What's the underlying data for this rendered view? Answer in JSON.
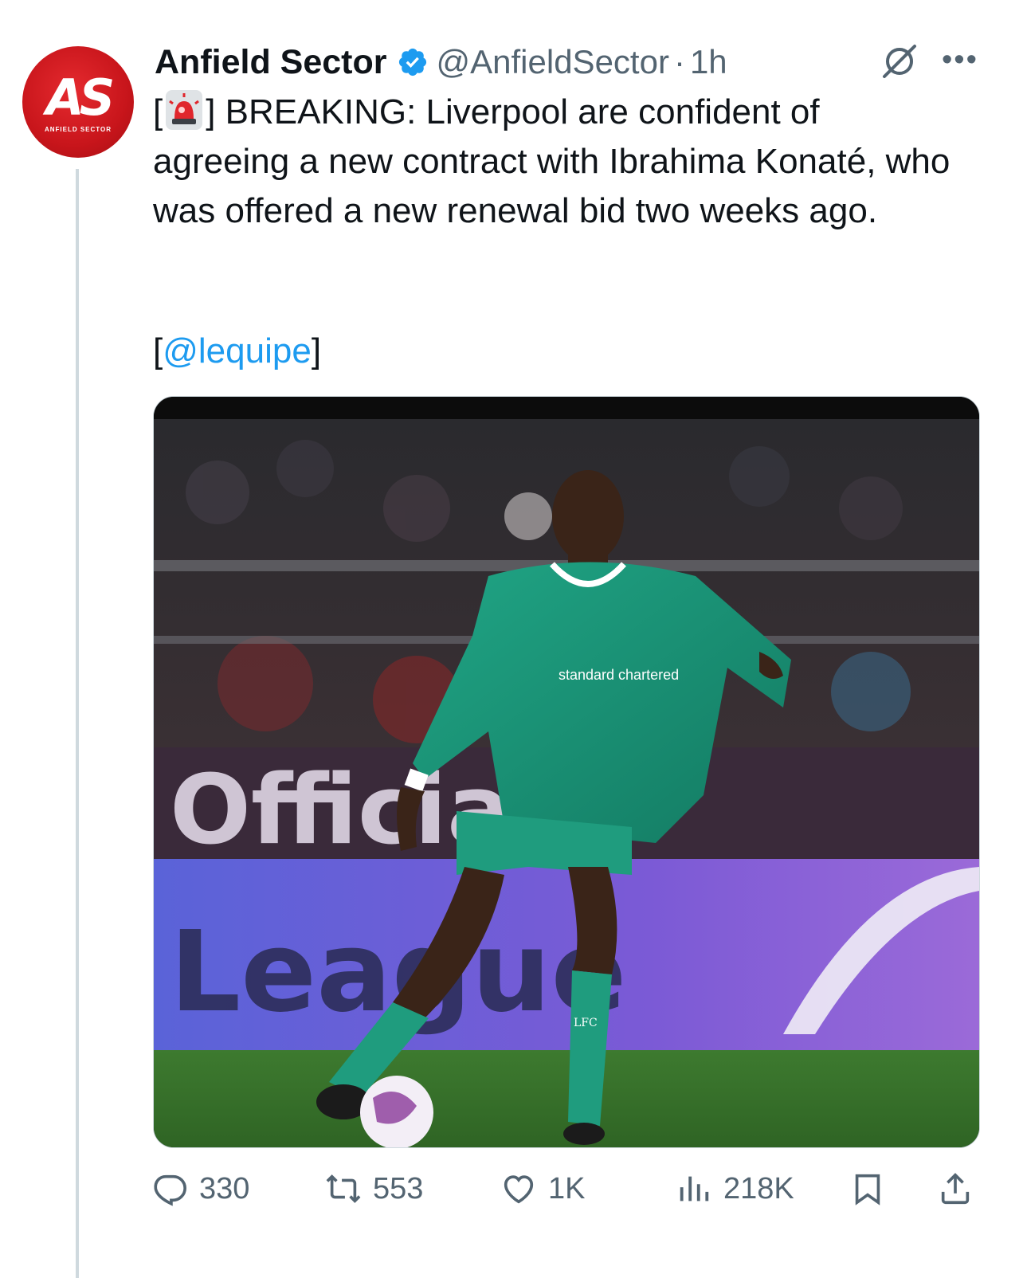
{
  "account": {
    "display_name": "Anfield Sector",
    "handle": "@AnfieldSector",
    "separator": "·",
    "time": "1h",
    "avatar_monogram": "AS",
    "avatar_subtext": "ANFIELD SECTOR"
  },
  "tweet": {
    "bracket_open": "[",
    "siren_icon": "police-siren-emoji",
    "text": "] BREAKING: Liverpool are confident of agreeing a new contract with Ibrahima Konaté, who was offered a new renewal bid two weeks ago.",
    "source_open": "[",
    "source_mention": "@lequipe",
    "source_close": "]"
  },
  "media": {
    "kit_sponsor": "standard chartered",
    "socks_text": "LFC",
    "board_text_1": "League",
    "board_text_2": "Official"
  },
  "actions": {
    "replies": "330",
    "reposts": "553",
    "likes": "1K",
    "views": "218K"
  },
  "colors": {
    "accent": "#1d9bf0",
    "muted": "#536471",
    "brand_red": "#c8151b",
    "kit_green": "#1a9a7a"
  }
}
